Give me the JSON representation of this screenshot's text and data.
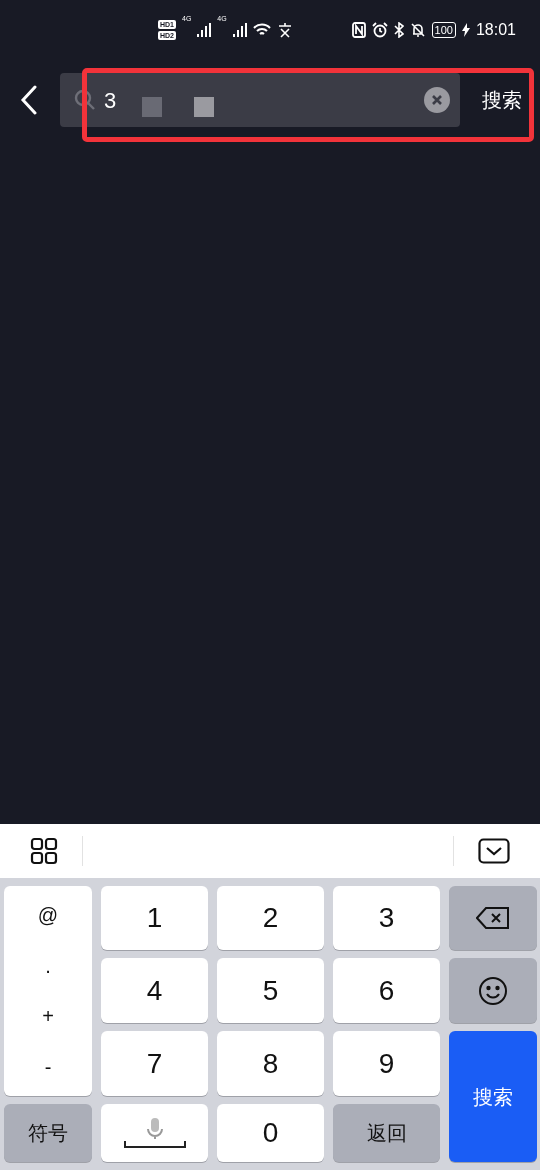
{
  "status_bar": {
    "sims": [
      {
        "label": "HD",
        "slot": "1",
        "network": "4G"
      },
      {
        "label": "HD",
        "slot": "2",
        "network": "4G"
      }
    ],
    "battery": "100",
    "time": "18:01"
  },
  "search": {
    "value": "3",
    "action": "搜索",
    "highlighted": true
  },
  "keyboard": {
    "side_keys": [
      "@",
      ".",
      "+",
      "-"
    ],
    "keys": [
      {
        "kind": "digit",
        "label": "1"
      },
      {
        "kind": "digit",
        "label": "2"
      },
      {
        "kind": "digit",
        "label": "3"
      },
      {
        "kind": "backspace"
      },
      {
        "kind": "digit",
        "label": "4"
      },
      {
        "kind": "digit",
        "label": "5"
      },
      {
        "kind": "digit",
        "label": "6"
      },
      {
        "kind": "emoji"
      },
      {
        "kind": "digit",
        "label": "7"
      },
      {
        "kind": "digit",
        "label": "8"
      },
      {
        "kind": "digit",
        "label": "9"
      },
      {
        "kind": "enter",
        "label": "搜索"
      },
      {
        "kind": "function",
        "label": "符号"
      },
      {
        "kind": "space"
      },
      {
        "kind": "digit",
        "label": "0"
      },
      {
        "kind": "function",
        "label": "返回"
      }
    ]
  }
}
